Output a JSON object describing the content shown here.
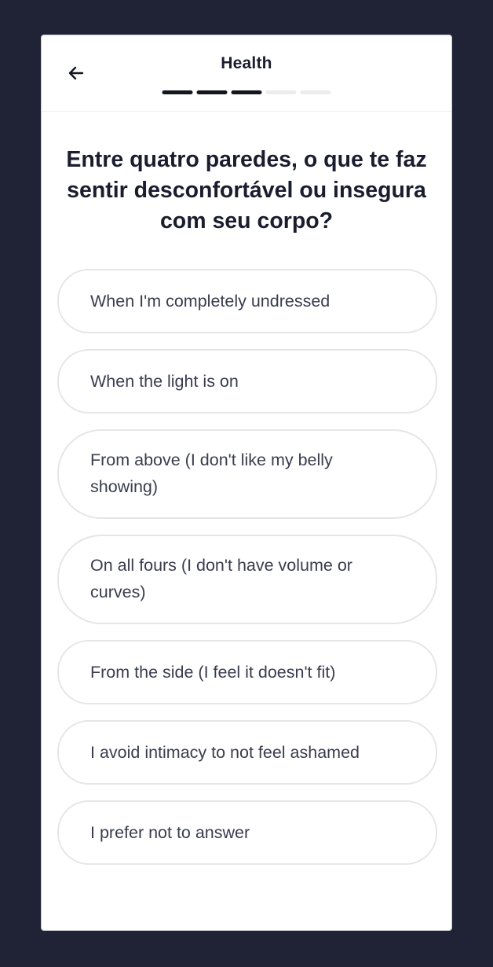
{
  "header": {
    "title": "Health",
    "progress": {
      "current_step": 3,
      "total_steps": 5
    }
  },
  "question": "Entre quatro paredes, o que te faz sentir desconfortável ou insegura com seu corpo?",
  "options": [
    {
      "label": "When I'm completely undressed"
    },
    {
      "label": "When the light is on"
    },
    {
      "label": "From above (I don't like my belly showing)"
    },
    {
      "label": "On all fours (I don't have volume or curves)"
    },
    {
      "label": "From the side (I feel it doesn't fit)"
    },
    {
      "label": "I avoid intimacy to not feel ashamed"
    },
    {
      "label": "I prefer not to answer"
    }
  ],
  "colors": {
    "page_background": "#1f2335",
    "card_background": "#ffffff",
    "progress_done": "#14161f",
    "progress_todo": "#ececee",
    "option_border": "#e6e6e8"
  },
  "icons": {
    "back": "arrow-left-icon"
  }
}
